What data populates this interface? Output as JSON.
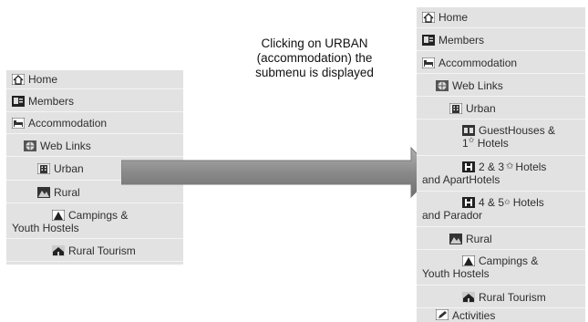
{
  "annotation": {
    "lines": [
      "Clicking on URBAN",
      "(accommodation) the",
      "submenu is displayed"
    ]
  },
  "left_menu": {
    "home": "Home",
    "members": "Members",
    "accommodation": "Accommodation",
    "web_links": "Web Links",
    "urban": "Urban",
    "rural": "Rural",
    "campings_line1": "Campings &",
    "campings_line2": "Youth Hostels",
    "rural_tourism": "Rural Tourism"
  },
  "right_menu": {
    "home": "Home",
    "members": "Members",
    "accommodation": "Accommodation",
    "web_links": "Web Links",
    "urban": "Urban",
    "guesthouses_line1": "GuestHouses &",
    "guesthouses_line2": "Hotels",
    "guesthouses_num": "1",
    "hotels23_line1_a": "2 & 3",
    "hotels23_line1_b": "Hotels",
    "hotels23_line2": "and ApartHotels",
    "hotels45_line1_a": "4 & 5",
    "hotels45_line1_b": "Hotels",
    "hotels45_line2": "and Parador",
    "rural": "Rural",
    "campings_line1": "Campings &",
    "campings_line2": "Youth Hostels",
    "rural_tourism": "Rural Tourism",
    "activities": "Activities"
  },
  "icons": {
    "home": "home-icon",
    "members": "id-card-icon",
    "accommodation": "bed-icon",
    "web_links": "globe-icon",
    "urban": "building-icon",
    "rural": "mountain-icon",
    "campings": "tent-icon",
    "rural_tourism": "farmhouse-icon",
    "guesthouses": "guesthouse-icon",
    "hotel": "hotel-h-icon",
    "activities": "pencil-icon"
  },
  "colors": {
    "menu_bg": "#e2e2e2",
    "arrow": "#8a8a8a"
  }
}
